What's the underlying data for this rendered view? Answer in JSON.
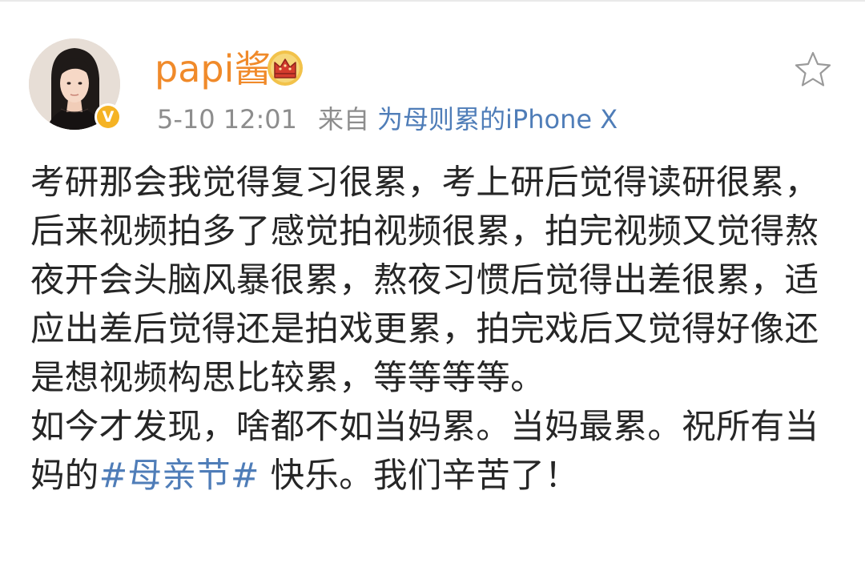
{
  "post": {
    "author": {
      "name": "papi酱",
      "avatar_icon": "profile-photo",
      "verified_icon": "verified-v-badge",
      "membership_icon": "crown-badge"
    },
    "meta": {
      "timestamp": "5-10 12:01",
      "from_label": "来自",
      "source": "为母则累的iPhone X"
    },
    "actions": {
      "favorite_icon": "star-outline-icon"
    },
    "content": {
      "paragraph_1": "考研那会我觉得复习很累，考上研后觉得读研很累，后来视频拍多了感觉拍视频很累，拍完视频又觉得熬夜开会头脑风暴很累，熬夜习惯后觉得出差很累，适应出差后觉得还是拍戏更累，拍完戏后又觉得好像还是想视频构思比较累，等等等等。",
      "paragraph_2_before": "如今才发现，啥都不如当妈累。当妈最累。祝所有当妈的",
      "hashtag": "#母亲节#",
      "paragraph_2_after": " 快乐。我们辛苦了！"
    },
    "colors": {
      "username": "#f08a2a",
      "link": "#4f7db8",
      "meta": "#8d8d8d",
      "text": "#262626",
      "verified_badge": "#f5b324"
    }
  }
}
